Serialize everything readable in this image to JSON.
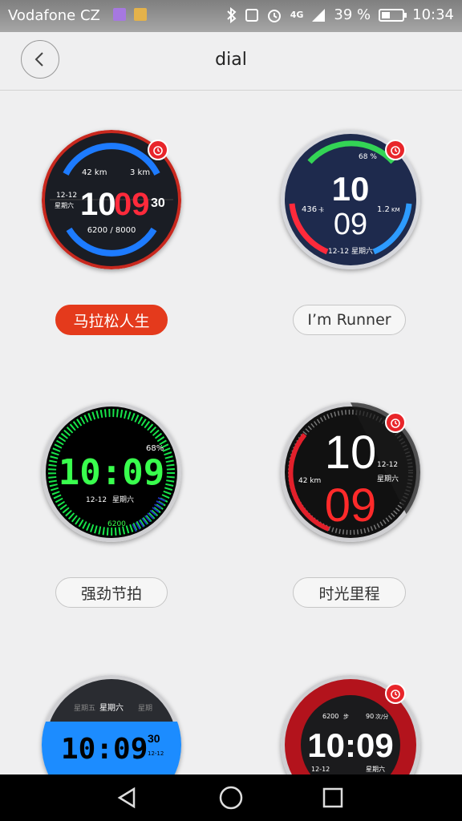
{
  "status_bar": {
    "carrier": "Vodafone CZ",
    "network": "4G",
    "battery": "39 %",
    "time": "10:34"
  },
  "header": {
    "title": "dial"
  },
  "dials": [
    {
      "label": "马拉松人生",
      "selected": true,
      "face": {
        "hour": "10",
        "minute": "09",
        "seconds": "30",
        "date": "12-12",
        "weekday": "星期六",
        "distance_a": "42 km",
        "distance_b": "3 km",
        "steps": "6200 / 8000"
      }
    },
    {
      "label": "I’m Runner",
      "selected": false,
      "face": {
        "hour": "10",
        "minute": "09",
        "battery": "68 %",
        "calories": "436",
        "calories_unit": "卡",
        "distance": "1.2",
        "distance_unit": "KM",
        "date_weekday": "12-12 星期六"
      }
    },
    {
      "label": "强劲节拍",
      "selected": false,
      "face": {
        "time": "10:09",
        "battery": "68%",
        "date": "12-12",
        "weekday": "星期六",
        "steps": "6200"
      }
    },
    {
      "label": "时光里程",
      "selected": false,
      "face": {
        "hour": "10",
        "minute": "09",
        "distance": "42 km",
        "date": "12-12",
        "weekday": "星期六"
      }
    },
    {
      "label": "",
      "selected": false,
      "face": {
        "time": "10:09",
        "seconds": "30",
        "date": "12-12",
        "weekday_prev": "星期五",
        "weekday": "星期六",
        "weekday_next": "星期"
      }
    },
    {
      "label": "",
      "selected": false,
      "face": {
        "time": "10:09",
        "steps": "6200",
        "steps_unit": "步",
        "heart_rate": "90",
        "heart_unit": "次/分",
        "date": "12-12",
        "weekday": "星期六"
      }
    }
  ],
  "colors": {
    "accent": "#e43a1c",
    "badge": "#e8252a",
    "background": "#efeff0"
  },
  "icons": {
    "back": "chevron-left-icon",
    "badge": "watch-alarm-icon",
    "nav": [
      "back-triangle-icon",
      "home-circle-icon",
      "recents-square-icon"
    ]
  }
}
